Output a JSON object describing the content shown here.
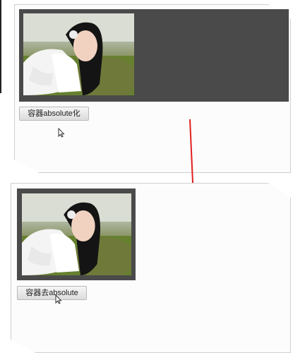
{
  "top_demo": {
    "button_label": "容器absolute化"
  },
  "bottom_demo": {
    "button_label": "容器去absolute"
  },
  "icons": {
    "cursor": "mouse-pointer-icon",
    "arrow": "down-arrow-icon"
  },
  "colors": {
    "dark_panel": "#4a4a4a",
    "arrow": "#e02020",
    "card_bg": "#fcfcfc"
  }
}
